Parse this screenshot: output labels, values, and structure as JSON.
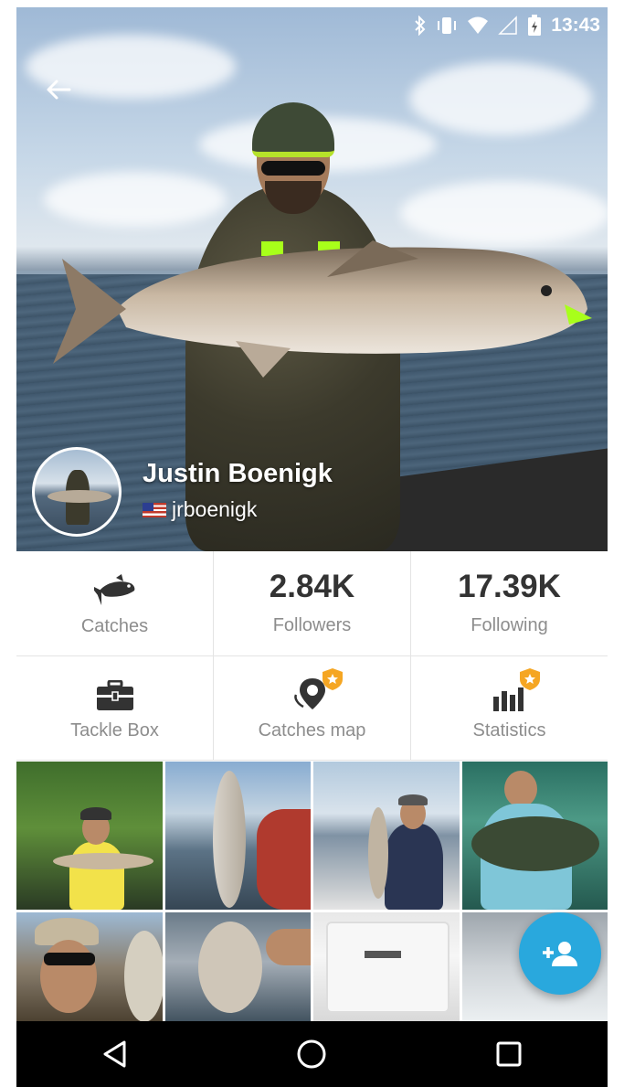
{
  "status_bar": {
    "time": "13:43",
    "icons": [
      "bluetooth-icon",
      "vibrate-icon",
      "wifi-icon",
      "signal-icon",
      "battery-icon"
    ]
  },
  "header": {
    "back_icon": "arrow-left-icon"
  },
  "profile": {
    "name": "Justin Boenigk",
    "username": "jrboenigk",
    "country_flag": "us-flag-icon"
  },
  "stats": [
    {
      "label": "Catches",
      "icon": "fish-icon"
    },
    {
      "label": "Followers",
      "value": "2.84K"
    },
    {
      "label": "Following",
      "value": "17.39K"
    }
  ],
  "actions": [
    {
      "label": "Tackle Box",
      "icon": "tackle-box-icon"
    },
    {
      "label": "Catches map",
      "icon": "map-pin-icon",
      "premium": true
    },
    {
      "label": "Statistics",
      "icon": "bar-chart-icon",
      "premium": true
    }
  ],
  "photos_count": 8,
  "fab": {
    "icon": "add-person-icon"
  },
  "colors": {
    "accent": "#29a8dd",
    "premium_badge": "#f5a623",
    "nav_bar": "#000000"
  },
  "nav_bar": {
    "buttons": [
      "back-triangle-icon",
      "home-circle-icon",
      "recents-square-icon"
    ]
  }
}
